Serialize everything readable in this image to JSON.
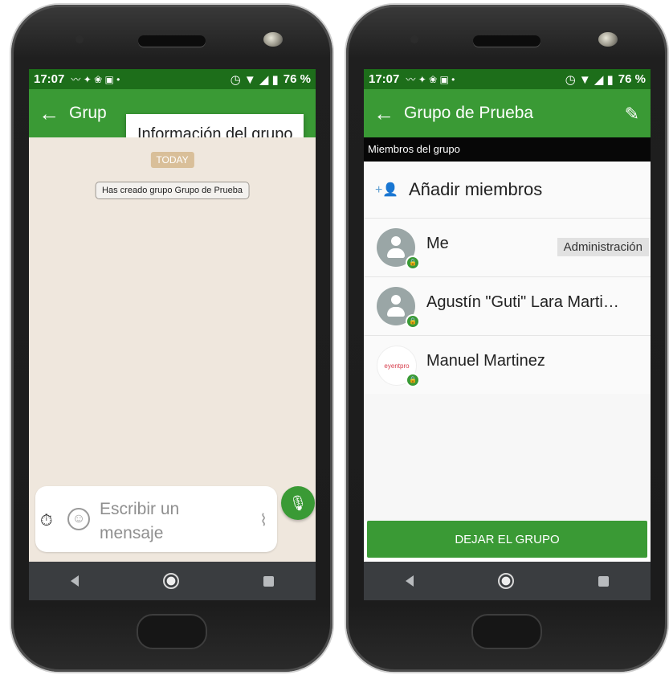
{
  "status": {
    "time": "17:07",
    "battery": "76 %"
  },
  "left_screen": {
    "title_partial": "Grup",
    "tooltip": "Información del grupo",
    "today_badge": "TODAY",
    "system_message": "Has creado grupo Grupo de Prueba",
    "input_placeholder": "Escribir un mensaje"
  },
  "right_screen": {
    "title": "Grupo de Prueba",
    "section_header": "Miembros del grupo",
    "add_members": "Añadir miembros",
    "members": [
      {
        "name": "Me",
        "badge": "Administración"
      },
      {
        "name": "Agustín \"Guti\" Lara Marti…",
        "badge": ""
      },
      {
        "name": "Manuel Martinez",
        "badge": ""
      }
    ],
    "leave_button": "DEJAR EL GRUPO",
    "logo_text": "eyentpro"
  },
  "colors": {
    "primary": "#3a9a35",
    "statusbar": "#1d6e1a",
    "chat_bg": "#efe7dd"
  }
}
